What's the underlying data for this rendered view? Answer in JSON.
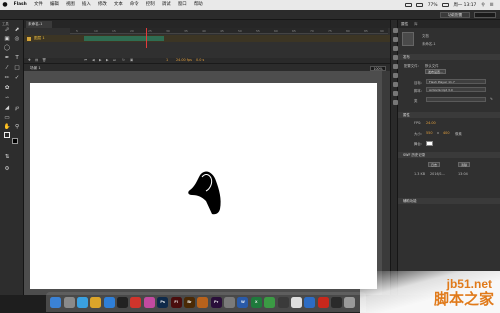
{
  "menubar": {
    "app": "Flash",
    "items": [
      "文件",
      "编辑",
      "视图",
      "插入",
      "修改",
      "文本",
      "命令",
      "控制",
      "调试",
      "窗口",
      "帮助"
    ],
    "battery": "77%",
    "clock": "周一 13:17"
  },
  "appbar": {
    "workspace": "功能配置"
  },
  "tools": {
    "label": "工具"
  },
  "document": {
    "tab": "未命名-1",
    "scene": "场景 1"
  },
  "timeline": {
    "layer": "图层 1",
    "ticks": [
      "5",
      "10",
      "15",
      "20",
      "25",
      "30",
      "35",
      "40",
      "45",
      "50",
      "55",
      "60",
      "65",
      "70",
      "75",
      "80",
      "85",
      "90"
    ],
    "frame": "1",
    "fps": "24.00 fps",
    "time": "0.0 s"
  },
  "stage": {
    "zoom": "100%"
  },
  "properties": {
    "tabs": [
      "属性",
      "库"
    ],
    "doc_type": "文档",
    "doc_name": "未命名-1",
    "publish_section": "发布",
    "profile_label": "配置文件：",
    "profile_value": "默认文件",
    "publish_settings": "发布设置...",
    "target_label": "目标：",
    "target_value": "Flash Player 11.7",
    "script_label": "脚本：",
    "script_value": "ActionScript 3.0",
    "class_label": "类",
    "props_section": "属性",
    "fps_label": "FPS:",
    "fps_value": "24.00",
    "size_label": "大小:",
    "width": "550",
    "height": "400",
    "unit": "像素",
    "stage_label": "舞台:",
    "history_section": "SWF 历史记录",
    "log_btn": "日志",
    "clear_btn": "清除",
    "log_size": "1.3 KB",
    "log_date": "2016/1...",
    "log_time": "13:04",
    "accessibility_section": "辅助功能"
  },
  "dock": {
    "apps": [
      {
        "name": "finder",
        "label": "",
        "color": "#3b82d6"
      },
      {
        "name": "launchpad",
        "label": "",
        "color": "#8a8a8a"
      },
      {
        "name": "safari",
        "label": "",
        "color": "#3aa0e0"
      },
      {
        "name": "chrome",
        "label": "",
        "color": "#dca52a"
      },
      {
        "name": "app-blue",
        "label": "",
        "color": "#2f7fd8"
      },
      {
        "name": "qq",
        "label": "",
        "color": "#222222"
      },
      {
        "name": "app-red",
        "label": "",
        "color": "#d0342c"
      },
      {
        "name": "photos",
        "label": "",
        "color": "#c24aa0"
      },
      {
        "name": "photoshop",
        "label": "Ps",
        "color": "#0f2a4a"
      },
      {
        "name": "flash",
        "label": "Fl",
        "color": "#4a0d0d"
      },
      {
        "name": "bridge",
        "label": "Br",
        "color": "#4a2a06"
      },
      {
        "name": "app-orange",
        "label": "",
        "color": "#b8621c"
      },
      {
        "name": "premiere",
        "label": "Pr",
        "color": "#2a0f3a"
      },
      {
        "name": "app-gray",
        "label": "",
        "color": "#7a7a7a"
      },
      {
        "name": "word",
        "label": "W",
        "color": "#2a5aa8"
      },
      {
        "name": "excel",
        "label": "X",
        "color": "#1f7a3c"
      },
      {
        "name": "app-green",
        "label": "",
        "color": "#3b9a44"
      },
      {
        "name": "app-dark",
        "label": "",
        "color": "#3a3a3a"
      },
      {
        "name": "app-circle",
        "label": "",
        "color": "#dddddd"
      },
      {
        "name": "app-blue2",
        "label": "",
        "color": "#2d6cc4"
      },
      {
        "name": "flash-player",
        "label": "",
        "color": "#c8281c"
      },
      {
        "name": "app-dark2",
        "label": "",
        "color": "#2a2a2a"
      },
      {
        "name": "trash",
        "label": "",
        "color": "#9a9a9a"
      }
    ]
  },
  "watermark": {
    "line1": "jb51.net",
    "line2": "脚本之家"
  }
}
